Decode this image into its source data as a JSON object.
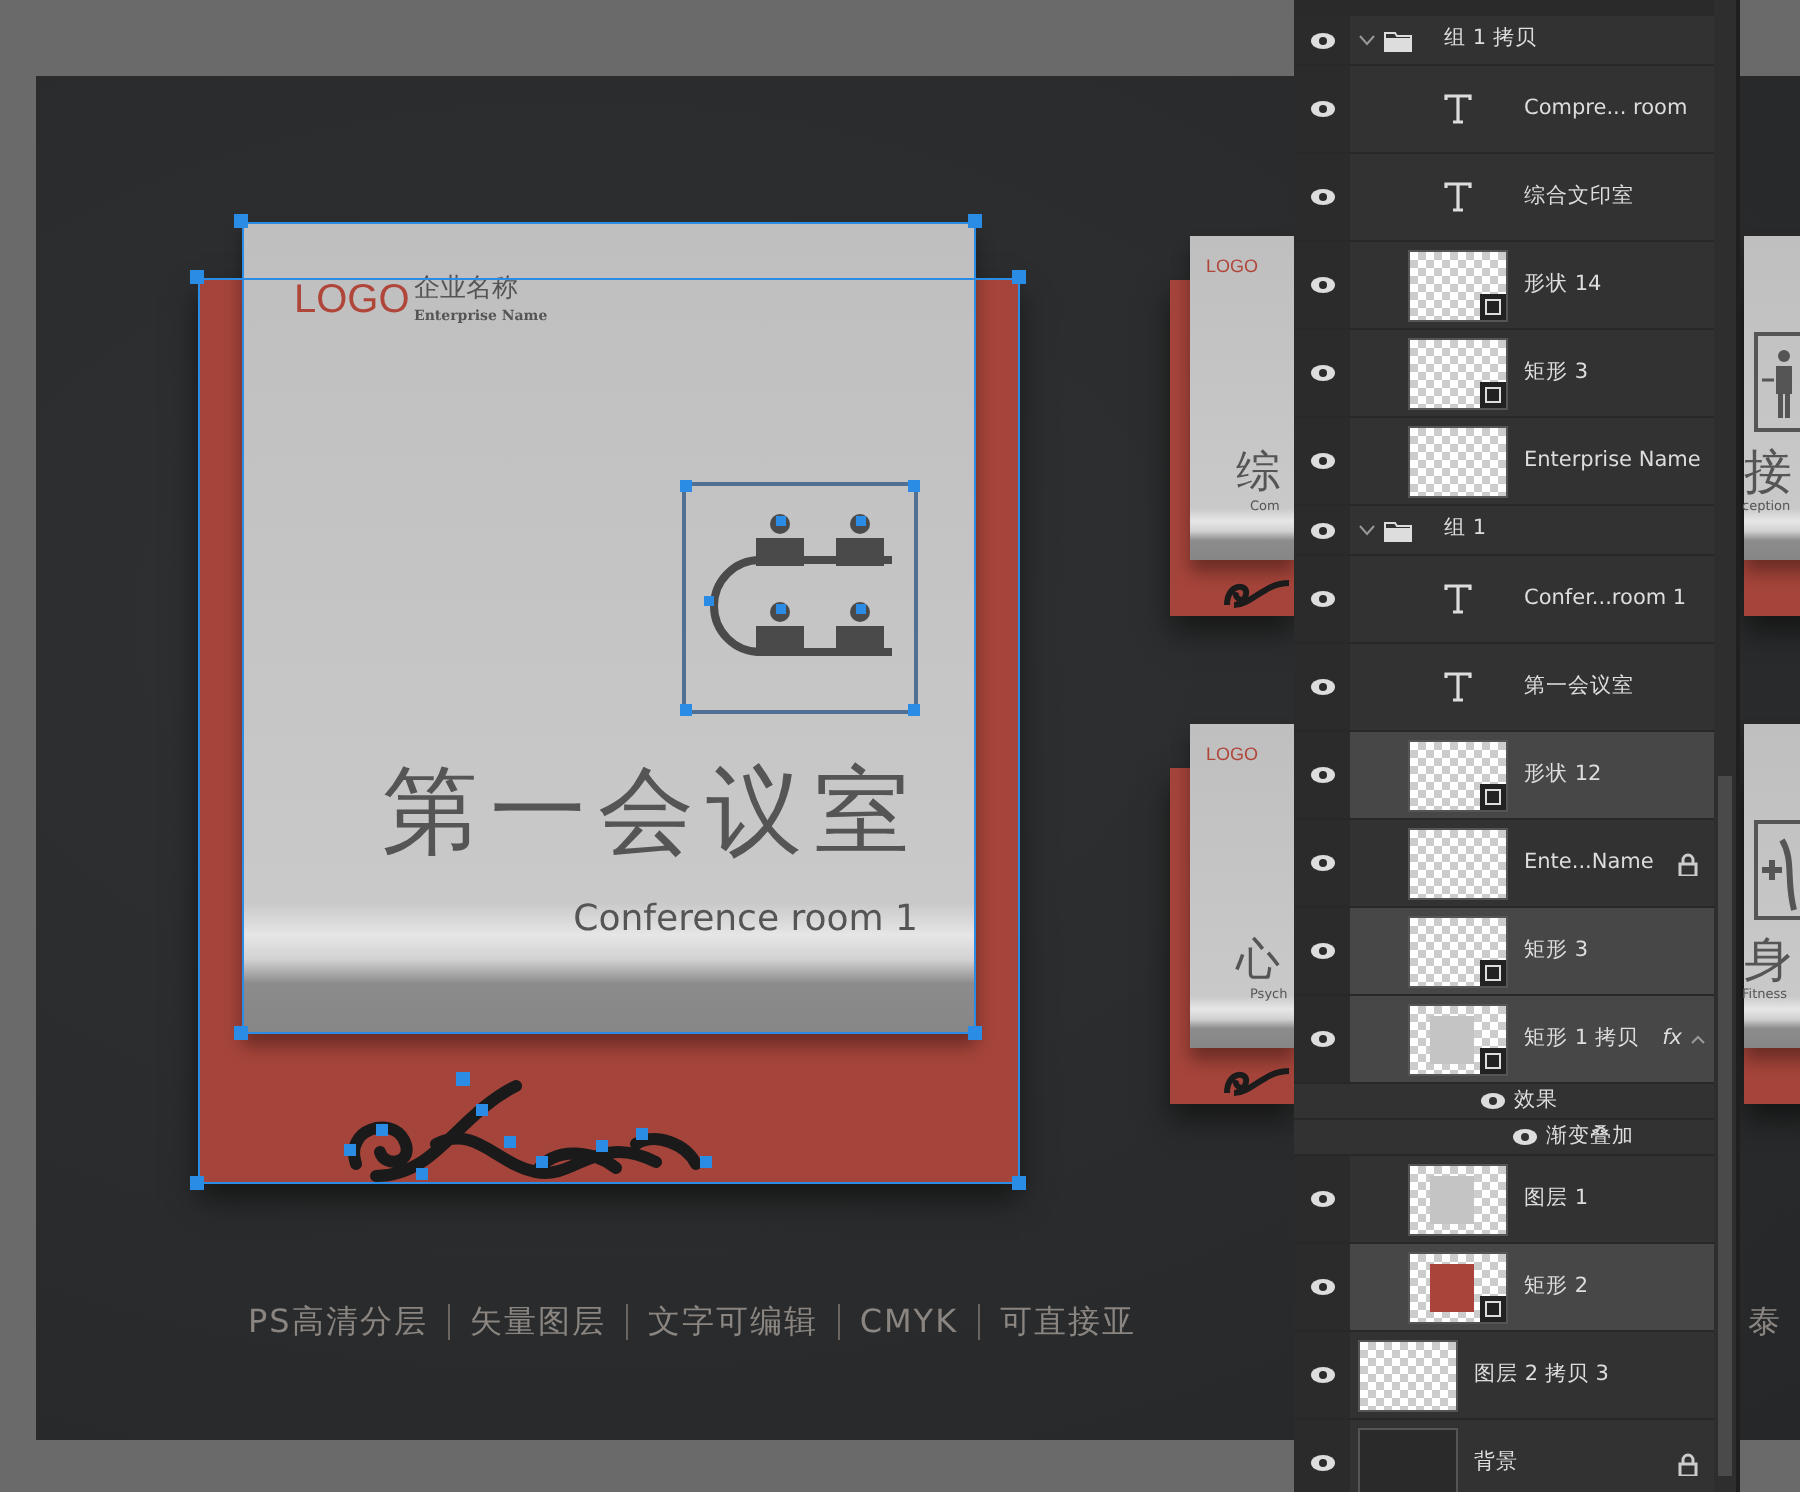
{
  "canvas": {
    "main_sign": {
      "logo": "LOGO",
      "company": "企业名称",
      "company_en": "Enterprise Name",
      "title": "第一会议室",
      "subtitle": "Conference room 1"
    },
    "side_signs": [
      {
        "kind": "left",
        "logo": "LOGO",
        "title": "综",
        "subtitle": "Com"
      },
      {
        "kind": "left",
        "logo": "LOGO",
        "title": "心",
        "subtitle": "Psych"
      },
      {
        "kind": "right",
        "title": "接",
        "subtitle": "ception"
      },
      {
        "kind": "right",
        "title": "身",
        "subtitle": "Fitness"
      }
    ],
    "features": [
      "PS高清分层",
      "矢量图层",
      "文字可编辑",
      "CMYK",
      "可直接亚"
    ],
    "feature_fragment": "泰"
  },
  "layers_panel": {
    "layers": [
      {
        "kind": "group",
        "name": "组 1 拷贝",
        "visible": true,
        "selected": false,
        "expanded": true,
        "children": [
          {
            "kind": "text",
            "name": "Compre... room",
            "visible": true,
            "selected": false
          },
          {
            "kind": "text",
            "name": "综合文印室",
            "visible": true,
            "selected": false
          },
          {
            "kind": "layer",
            "name": "形状 14",
            "visible": true,
            "selected": false,
            "vector": true
          },
          {
            "kind": "layer",
            "name": "矩形 3",
            "visible": true,
            "selected": false,
            "vector": true
          },
          {
            "kind": "layer",
            "name": "Enterprise Name",
            "visible": true,
            "selected": false
          }
        ]
      },
      {
        "kind": "group",
        "name": "组 1",
        "visible": true,
        "selected": false,
        "expanded": true,
        "children": [
          {
            "kind": "text",
            "name": "Confer...room 1",
            "visible": true,
            "selected": false
          },
          {
            "kind": "text",
            "name": "第一会议室",
            "visible": true,
            "selected": false
          },
          {
            "kind": "layer",
            "name": "形状 12",
            "visible": true,
            "selected": true,
            "vector": true
          },
          {
            "kind": "layer",
            "name": "Ente...Name",
            "visible": true,
            "selected": false,
            "locked": true
          },
          {
            "kind": "layer",
            "name": "矩形 3",
            "visible": true,
            "selected": true,
            "vector": true
          },
          {
            "kind": "layer",
            "name": "矩形 1 拷贝",
            "visible": true,
            "selected": true,
            "vector": true,
            "color": "#c4c4c4",
            "fx": "fx",
            "effects": {
              "label": "效果",
              "visible": true,
              "items": [
                {
                  "name": "渐变叠加",
                  "visible": true
                }
              ]
            }
          },
          {
            "kind": "layer",
            "name": "图层 1",
            "visible": true,
            "selected": false,
            "color": "#c4c4c4"
          },
          {
            "kind": "layer",
            "name": "矩形 2",
            "visible": true,
            "selected": true,
            "vector": true,
            "color": "#a8443a"
          }
        ]
      },
      {
        "kind": "layer",
        "name": "图层 2 拷贝 3",
        "visible": true,
        "selected": false
      },
      {
        "kind": "background",
        "name": "背景",
        "visible": true,
        "selected": false,
        "locked": true,
        "color": "#2a2a2a"
      }
    ]
  }
}
